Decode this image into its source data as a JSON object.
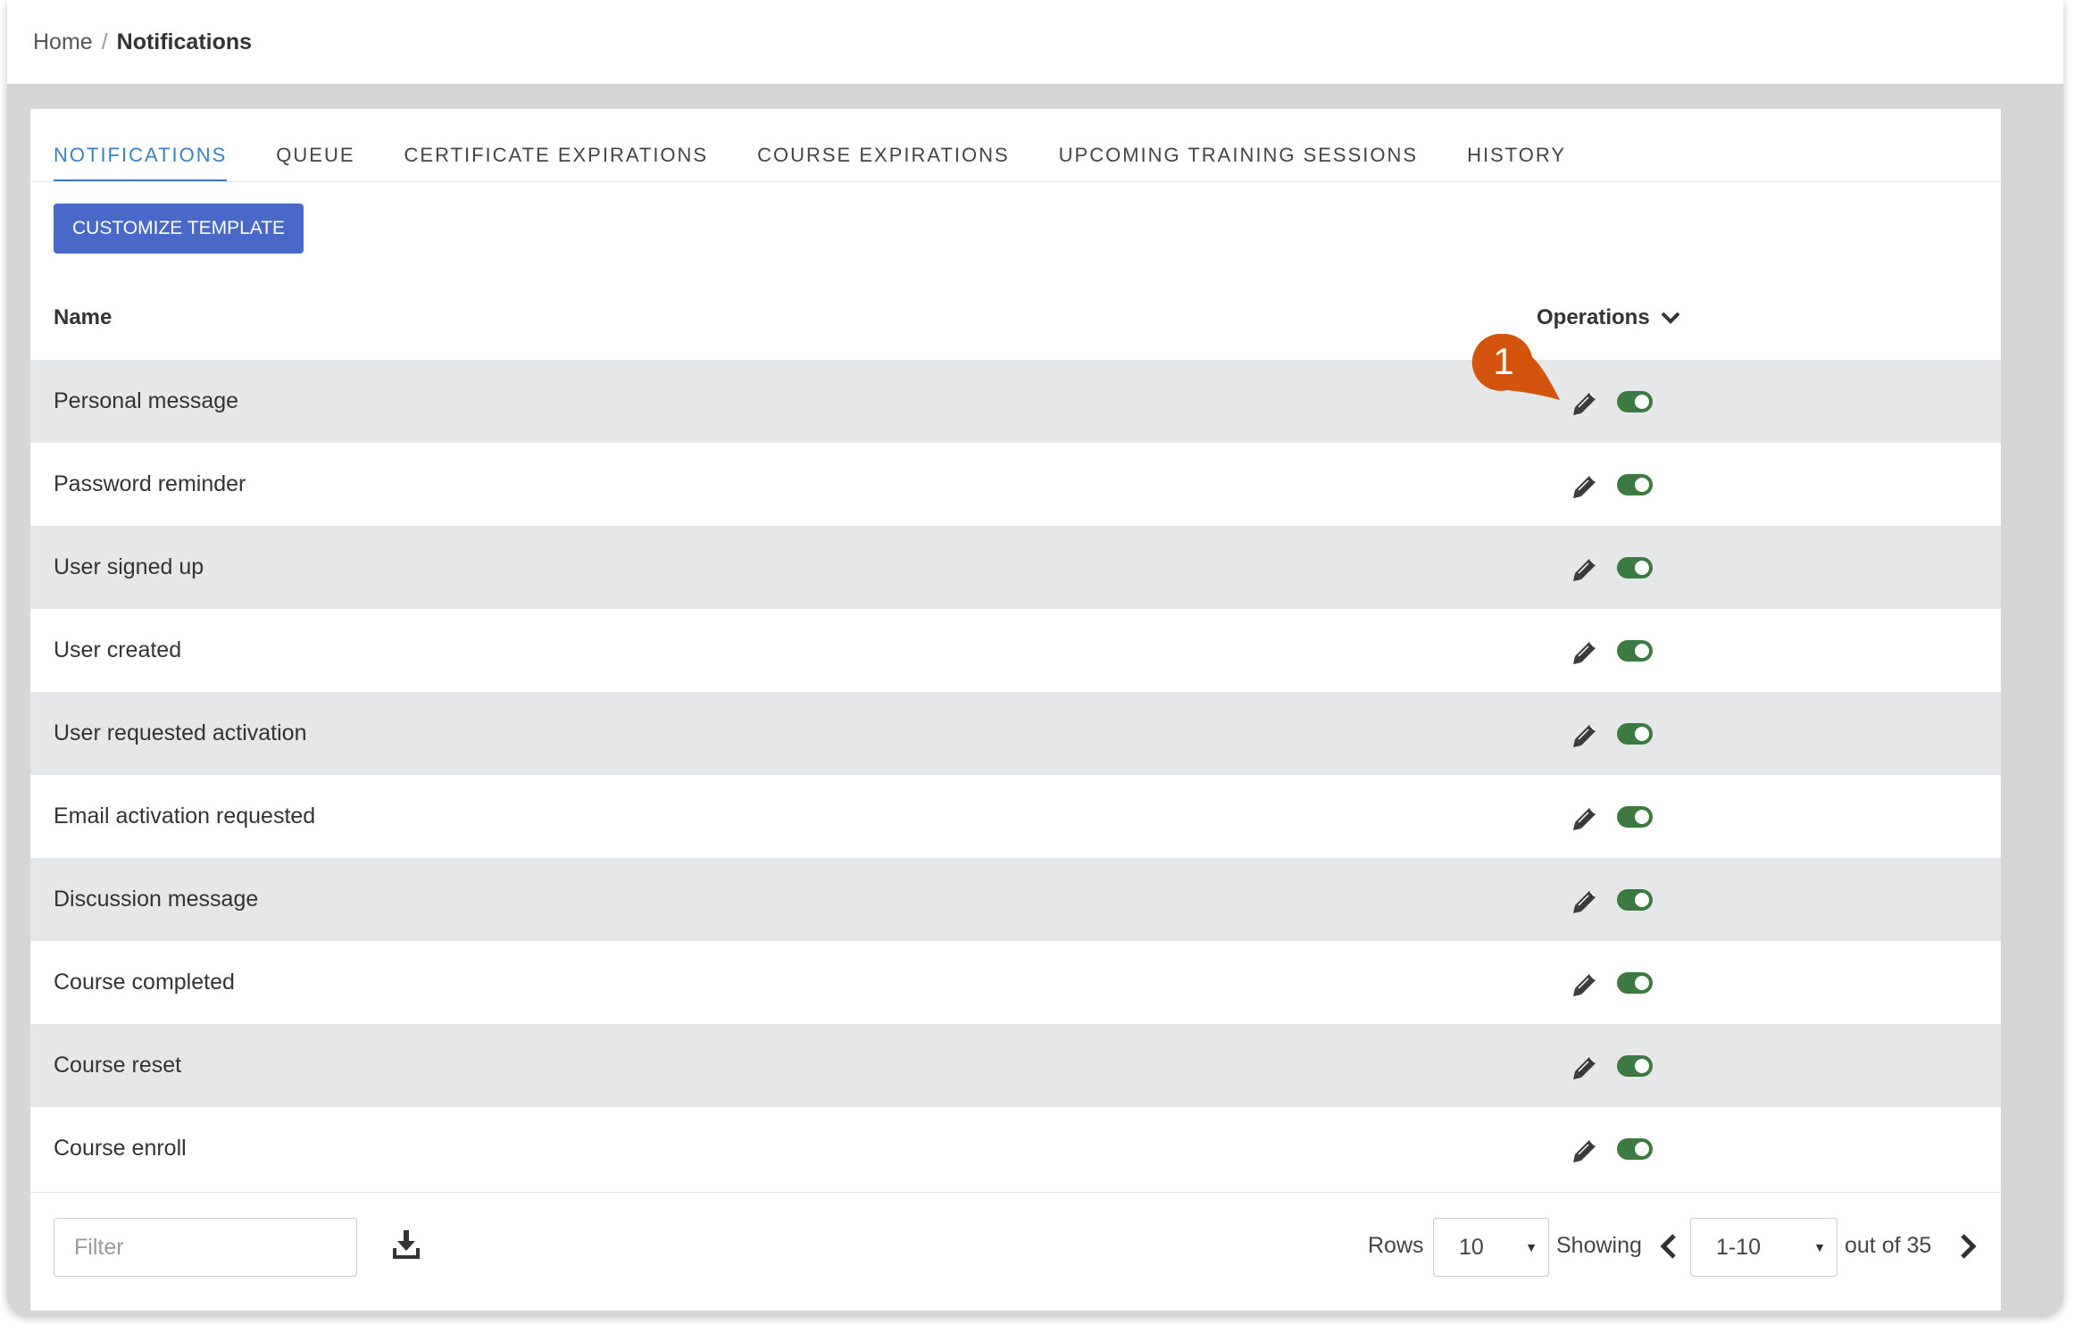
{
  "breadcrumb": {
    "home": "Home",
    "separator": "/",
    "current": "Notifications"
  },
  "tabs": [
    {
      "label": "NOTIFICATIONS",
      "active": true
    },
    {
      "label": "QUEUE",
      "active": false
    },
    {
      "label": "CERTIFICATE EXPIRATIONS",
      "active": false
    },
    {
      "label": "COURSE EXPIRATIONS",
      "active": false
    },
    {
      "label": "UPCOMING TRAINING SESSIONS",
      "active": false
    },
    {
      "label": "HISTORY",
      "active": false
    }
  ],
  "toolbar": {
    "customize_label": "CUSTOMIZE TEMPLATE"
  },
  "table": {
    "headers": {
      "name": "Name",
      "operations": "Operations"
    },
    "rows": [
      {
        "name": "Personal message",
        "enabled": true
      },
      {
        "name": "Password reminder",
        "enabled": true
      },
      {
        "name": "User signed up",
        "enabled": true
      },
      {
        "name": "User created",
        "enabled": true
      },
      {
        "name": "User requested activation",
        "enabled": true
      },
      {
        "name": "Email activation requested",
        "enabled": true
      },
      {
        "name": "Discussion message",
        "enabled": true
      },
      {
        "name": "Course completed",
        "enabled": true
      },
      {
        "name": "Course reset",
        "enabled": true
      },
      {
        "name": "Course enroll",
        "enabled": true
      }
    ]
  },
  "footer": {
    "filter_placeholder": "Filter",
    "rows_label": "Rows",
    "rows_value": "10",
    "showing_label": "Showing",
    "range_value": "1-10",
    "total_text": "out of 35"
  },
  "callout": {
    "number": "1"
  },
  "colors": {
    "accent": "#3a7fc0",
    "button": "#4a68c7",
    "toggle_on": "#3d7a3f",
    "callout": "#d4540e",
    "row_stripe": "#e6e7e9"
  },
  "icons": {
    "edit": "pencil-icon",
    "toggle": "toggle-on-icon",
    "sort": "chevron-down-icon",
    "download": "download-icon",
    "prev": "chevron-left-icon",
    "next": "chevron-right-icon"
  }
}
